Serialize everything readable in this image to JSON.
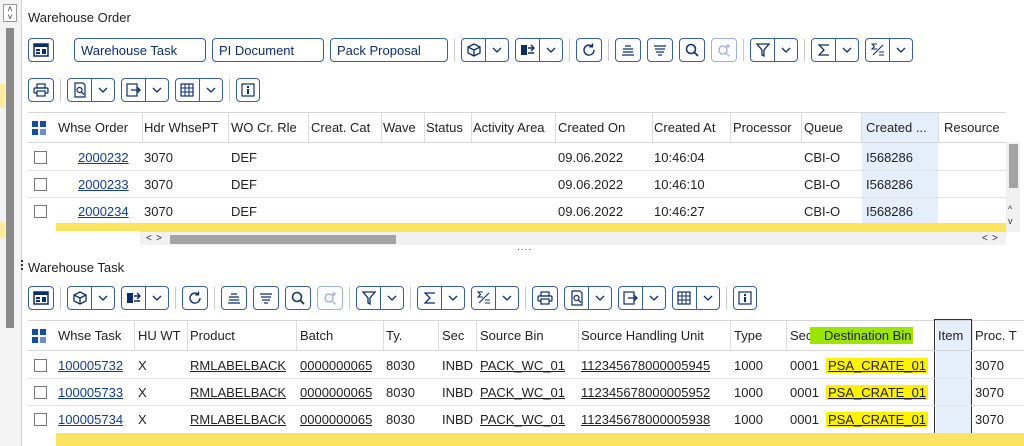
{
  "top_panel": {
    "title": "Warehouse Order",
    "toolbar_row1": {
      "buttons": [
        "Warehouse Task",
        "PI Document",
        "Pack Proposal"
      ]
    },
    "columns": [
      "Whse Order",
      "Hdr WhsePT",
      "WO Cr. Rle",
      "Creat. Cat",
      "Wave",
      "Status",
      "Activity Area",
      "Created On",
      "Created At",
      "Processor",
      "Queue",
      "Created ...",
      "Resource"
    ],
    "rows": [
      {
        "whse_order": "2000232",
        "hdr_whsept": "3070",
        "wo_cr_rle": "DEF",
        "created_on": "09.06.2022",
        "created_at": "10:46:04",
        "queue": "CBI-O",
        "created_by": "I568286"
      },
      {
        "whse_order": "2000233",
        "hdr_whsept": "3070",
        "wo_cr_rle": "DEF",
        "created_on": "09.06.2022",
        "created_at": "10:46:10",
        "queue": "CBI-O",
        "created_by": "I568286"
      },
      {
        "whse_order": "2000234",
        "hdr_whsept": "3070",
        "wo_cr_rle": "DEF",
        "created_on": "09.06.2022",
        "created_at": "10:46:27",
        "queue": "CBI-O",
        "created_by": "I568286"
      }
    ],
    "scroll": {
      "left": "<",
      "right": ">",
      "up": "^",
      "down": "v"
    }
  },
  "bottom_panel": {
    "title": "Warehouse Task",
    "columns": [
      "Whse Task",
      "HU WT",
      "Product",
      "Batch",
      "Ty.",
      "Sec",
      "Source Bin",
      "Source Handling Unit",
      "Type",
      "Sec.",
      "Destination Bin",
      "Item",
      "Proc. T"
    ],
    "rows": [
      {
        "whse_task": "100005732",
        "hu_wt": "X",
        "product": "RMLABELBACK",
        "batch": "0000000065",
        "ty": "8030",
        "sec": "INBD",
        "source_bin": "PACK_WC_01",
        "source_hu": "112345678000005945",
        "type": "1000",
        "sec2": "0001",
        "dest_bin": "PSA_CRATE_01",
        "proc_t": "3070"
      },
      {
        "whse_task": "100005733",
        "hu_wt": "X",
        "product": "RMLABELBACK",
        "batch": "0000000065",
        "ty": "8030",
        "sec": "INBD",
        "source_bin": "PACK_WC_01",
        "source_hu": "112345678000005952",
        "type": "1000",
        "sec2": "0001",
        "dest_bin": "PSA_CRATE_01",
        "proc_t": "3070"
      },
      {
        "whse_task": "100005734",
        "hu_wt": "X",
        "product": "RMLABELBACK",
        "batch": "0000000065",
        "ty": "8030",
        "sec": "INBD",
        "source_bin": "PACK_WC_01",
        "source_hu": "112345678000005938",
        "type": "1000",
        "sec2": "0001",
        "dest_bin": "PSA_CRATE_01",
        "proc_t": "3070"
      }
    ]
  },
  "splitter_dots": "....",
  "colors": {
    "accent": "#0b2e6b",
    "highlight_yellow": "#fce460",
    "column_highlight": "#e5effb",
    "green_marker": "#9be500",
    "yellow_marker": "#fff200"
  },
  "icons": [
    "layout-icon",
    "cube-icon",
    "transfer-icon",
    "refresh-icon",
    "align-center-icon",
    "align-lines-icon",
    "search-icon",
    "search-next-icon",
    "filter-icon",
    "sum-icon",
    "subtotal-icon",
    "print-icon",
    "preview-icon",
    "export-icon",
    "columns-icon",
    "info-icon",
    "chevron-down-icon",
    "select-all-icon"
  ]
}
